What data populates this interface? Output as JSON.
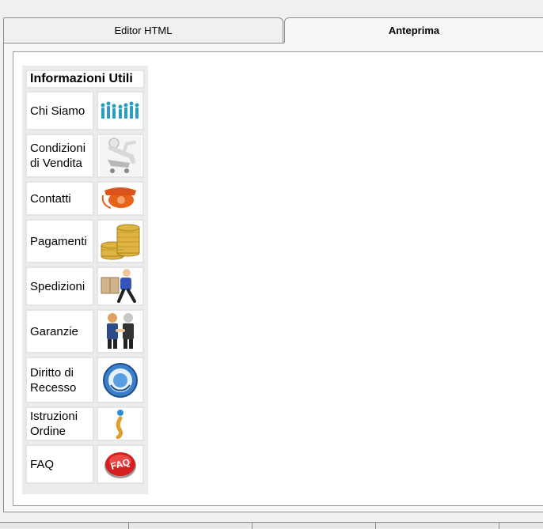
{
  "tabs": {
    "editor_label": "Editor HTML",
    "preview_label": "Anteprima"
  },
  "menu": {
    "title": "Informazioni Utili",
    "items": [
      {
        "label": "Chi Siamo",
        "icon": "people-group-icon"
      },
      {
        "label": "Condizioni\ndi Vendita",
        "icon": "person-relaxing-icon"
      },
      {
        "label": "Contatti",
        "icon": "telephone-icon"
      },
      {
        "label": "Pagamenti",
        "icon": "coins-stack-icon"
      },
      {
        "label": "Spedizioni",
        "icon": "delivery-person-icon"
      },
      {
        "label": "Garanzie",
        "icon": "handshake-icon"
      },
      {
        "label": "Diritto di\nRecesso",
        "icon": "return-circle-icon"
      },
      {
        "label": "Istruzioni\nOrdine",
        "icon": "info-icon"
      },
      {
        "label": "FAQ",
        "icon": "faq-button-icon"
      }
    ]
  },
  "colors": {
    "panel_bg": "#f7f7f7",
    "faq_red": "#d62020",
    "coin_gold": "#e0b440"
  }
}
